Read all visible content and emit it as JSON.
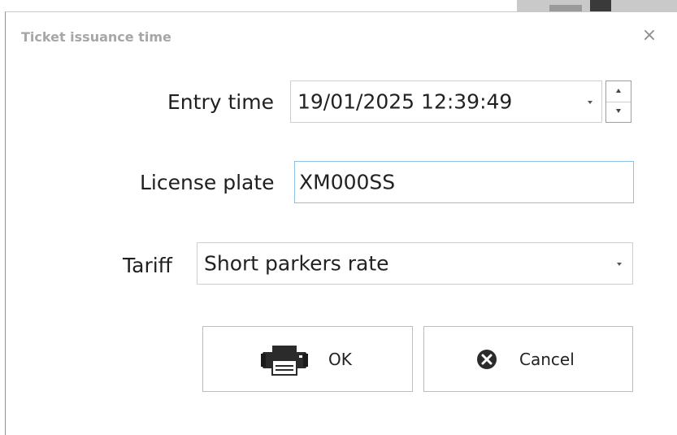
{
  "dialog": {
    "title": "Ticket issuance time",
    "close_glyph": "×"
  },
  "fields": {
    "entry_time": {
      "label": "Entry time",
      "value": "19/01/2025 12:39:49"
    },
    "license_plate": {
      "label": "License plate",
      "value": "XM000SS"
    },
    "tariff": {
      "label": "Tariff",
      "value": "Short parkers rate"
    }
  },
  "buttons": {
    "ok": {
      "label": "OK",
      "icon": "printer-icon"
    },
    "cancel": {
      "label": "Cancel",
      "icon": "cancel-circle-icon"
    }
  },
  "colors": {
    "focus_border": "#8fc0e6",
    "title_text": "#a6a6a6"
  }
}
